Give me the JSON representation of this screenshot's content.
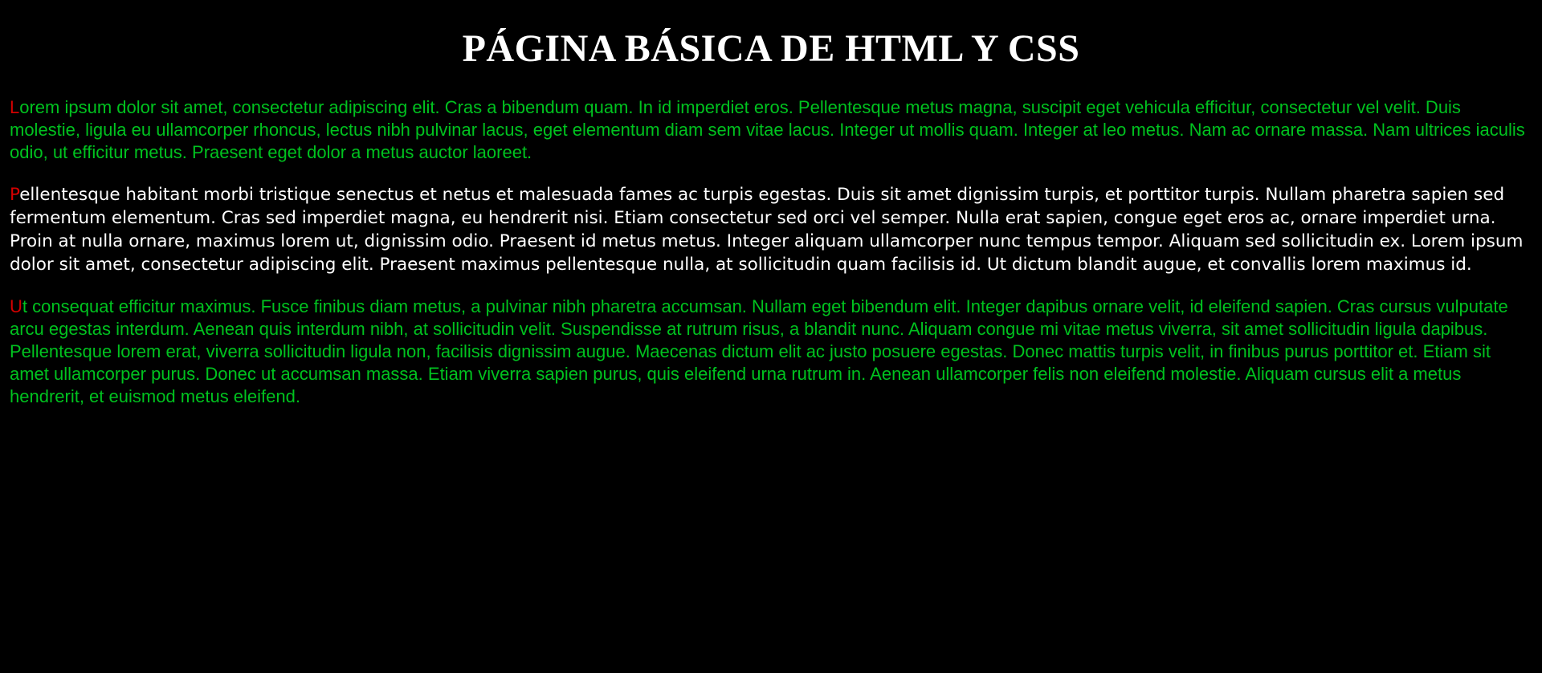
{
  "page": {
    "title": "PÁGINA BÁSICA DE HTML Y CSS"
  },
  "colors": {
    "background": "#000000",
    "title": "#ffffff",
    "green_text": "#00c21f",
    "white_text": "#ffffff",
    "first_letter": "#d40000"
  },
  "paragraphs": [
    {
      "initial": "L",
      "rest": "orem ipsum dolor sit amet, consectetur adipiscing elit. Cras a bibendum quam. In id imperdiet eros. Pellentesque metus magna, suscipit eget vehicula efficitur, consectetur vel velit. Duis molestie, ligula eu ullamcorper rhoncus, lectus nibh pulvinar lacus, eget elementum diam sem vitae lacus. Integer ut mollis quam. Integer at leo metus. Nam ac ornare massa. Nam ultrices iaculis odio, ut efficitur metus. Praesent eget dolor a metus auctor laoreet."
    },
    {
      "initial": "P",
      "rest": "ellentesque habitant morbi tristique senectus et netus et malesuada fames ac turpis egestas. Duis sit amet dignissim turpis, et porttitor turpis. Nullam pharetra sapien sed fermentum elementum. Cras sed imperdiet magna, eu hendrerit nisi. Etiam consectetur sed orci vel semper. Nulla erat sapien, congue eget eros ac, ornare imperdiet urna. Proin at nulla ornare, maximus lorem ut, dignissim odio. Praesent id metus metus. Integer aliquam ullamcorper nunc tempus tempor. Aliquam sed sollicitudin ex. Lorem ipsum dolor sit amet, consectetur adipiscing elit. Praesent maximus pellentesque nulla, at sollicitudin quam facilisis id. Ut dictum blandit augue, et convallis lorem maximus id."
    },
    {
      "initial": "U",
      "rest": "t consequat efficitur maximus. Fusce finibus diam metus, a pulvinar nibh pharetra accumsan. Nullam eget bibendum elit. Integer dapibus ornare velit, id eleifend sapien. Cras cursus vulputate arcu egestas interdum. Aenean quis interdum nibh, at sollicitudin velit. Suspendisse at rutrum risus, a blandit nunc. Aliquam congue mi vitae metus viverra, sit amet sollicitudin ligula dapibus. Pellentesque lorem erat, viverra sollicitudin ligula non, facilisis dignissim augue. Maecenas dictum elit ac justo posuere egestas. Donec mattis turpis velit, in finibus purus porttitor et. Etiam sit amet ullamcorper purus. Donec ut accumsan massa. Etiam viverra sapien purus, quis eleifend urna rutrum in. Aenean ullamcorper felis non eleifend molestie. Aliquam cursus elit a metus hendrerit, et euismod metus eleifend."
    }
  ]
}
